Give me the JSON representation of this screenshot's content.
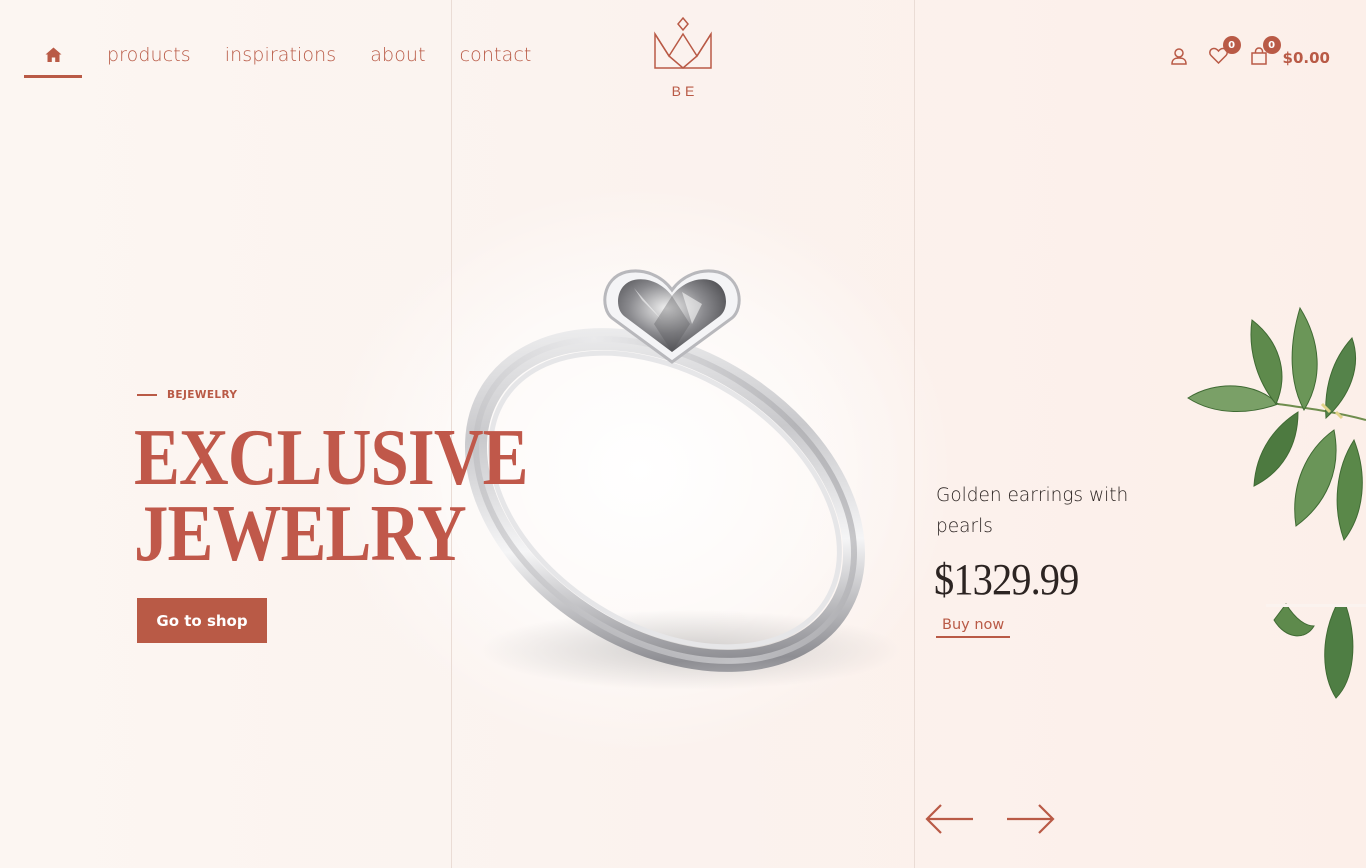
{
  "nav": {
    "home_icon": "home-icon",
    "links": [
      {
        "label": "products"
      },
      {
        "label": "inspirations"
      },
      {
        "label": "about"
      },
      {
        "label": "contact"
      }
    ]
  },
  "logo": {
    "text": "BE",
    "icon": "crown-icon"
  },
  "header_icons": {
    "user_icon": "user-icon",
    "wishlist": {
      "icon": "heart-icon",
      "count": "0"
    },
    "cart": {
      "icon": "bag-icon",
      "count": "0",
      "total": "$0.00"
    }
  },
  "hero": {
    "eyebrow": "BEJEWELRY",
    "headline_line1": "EXCLUSIVE",
    "headline_line2": "JEWELRY",
    "cta_label": "Go to shop"
  },
  "featured_product": {
    "name": "Golden earrings with pearls",
    "price": "$1329.99",
    "buy_label": "Buy now"
  },
  "slider": {
    "prev_icon": "arrow-left-icon",
    "next_icon": "arrow-right-icon"
  },
  "colors": {
    "accent": "#b95a46",
    "background": "#fbf3ef",
    "text_dark": "#2c2422",
    "leaf_green": "#5e8a4c"
  }
}
